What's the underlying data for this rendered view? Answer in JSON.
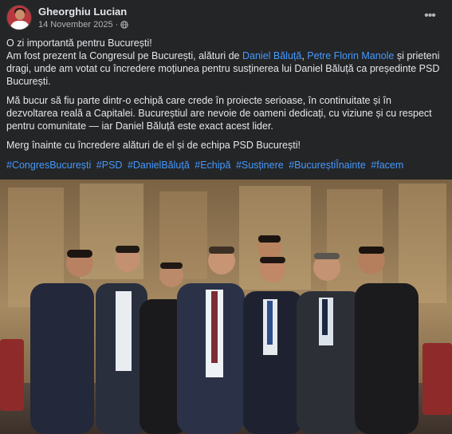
{
  "post": {
    "author": "Gheorghiu Lucian",
    "date": "14 November 2025",
    "date_separator": "·",
    "privacy_icon": "globe-icon",
    "more_icon": "more-options-icon",
    "text": {
      "line1": "O zi importantă pentru București!",
      "p1_before": "Am fost prezent la Congresul pe București, alături de ",
      "link1": "Daniel Băluță",
      "sep": ", ",
      "link2": "Petre Florin Manole",
      "p1_after": " și prieteni dragi, unde am votat cu încredere moțiunea pentru susținerea lui Daniel Băluță ca președinte PSD București.",
      "p2": "Mă bucur să fiu parte dintr-o echipă care crede în proiecte serioase, în continuitate și în dezvoltarea reală a Capitalei. Bucureștiul are nevoie de oameni dedicați, cu viziune și cu respect pentru comunitate — iar Daniel Băluță este exact acest lider.",
      "p3": "Merg înainte cu încredere alături de el și de echipa PSD București!"
    },
    "hashtags": [
      "#CongresBucurești",
      "#PSD",
      "#DanielBăluță",
      "#Echipă",
      "#Susținere",
      "#BucureștiÎnainte",
      "#facem"
    ],
    "photo_icon": "group-photo"
  },
  "colors": {
    "background": "#242526",
    "text": "#e4e6eb",
    "secondary": "#b0b3b8",
    "link": "#4599ff"
  }
}
